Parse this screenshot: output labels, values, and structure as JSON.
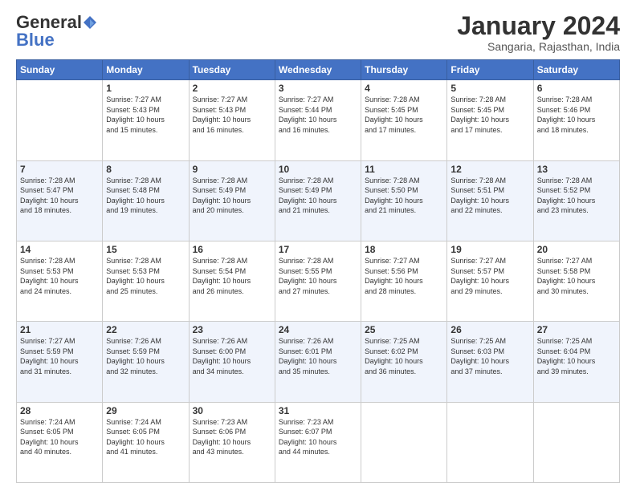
{
  "header": {
    "logo_general": "General",
    "logo_blue": "Blue",
    "month_title": "January 2024",
    "location": "Sangaria, Rajasthan, India"
  },
  "days_of_week": [
    "Sunday",
    "Monday",
    "Tuesday",
    "Wednesday",
    "Thursday",
    "Friday",
    "Saturday"
  ],
  "weeks": [
    [
      {
        "day": "",
        "content": ""
      },
      {
        "day": "1",
        "content": "Sunrise: 7:27 AM\nSunset: 5:43 PM\nDaylight: 10 hours\nand 15 minutes."
      },
      {
        "day": "2",
        "content": "Sunrise: 7:27 AM\nSunset: 5:43 PM\nDaylight: 10 hours\nand 16 minutes."
      },
      {
        "day": "3",
        "content": "Sunrise: 7:27 AM\nSunset: 5:44 PM\nDaylight: 10 hours\nand 16 minutes."
      },
      {
        "day": "4",
        "content": "Sunrise: 7:28 AM\nSunset: 5:45 PM\nDaylight: 10 hours\nand 17 minutes."
      },
      {
        "day": "5",
        "content": "Sunrise: 7:28 AM\nSunset: 5:45 PM\nDaylight: 10 hours\nand 17 minutes."
      },
      {
        "day": "6",
        "content": "Sunrise: 7:28 AM\nSunset: 5:46 PM\nDaylight: 10 hours\nand 18 minutes."
      }
    ],
    [
      {
        "day": "7",
        "content": "Sunrise: 7:28 AM\nSunset: 5:47 PM\nDaylight: 10 hours\nand 18 minutes."
      },
      {
        "day": "8",
        "content": "Sunrise: 7:28 AM\nSunset: 5:48 PM\nDaylight: 10 hours\nand 19 minutes."
      },
      {
        "day": "9",
        "content": "Sunrise: 7:28 AM\nSunset: 5:49 PM\nDaylight: 10 hours\nand 20 minutes."
      },
      {
        "day": "10",
        "content": "Sunrise: 7:28 AM\nSunset: 5:49 PM\nDaylight: 10 hours\nand 21 minutes."
      },
      {
        "day": "11",
        "content": "Sunrise: 7:28 AM\nSunset: 5:50 PM\nDaylight: 10 hours\nand 21 minutes."
      },
      {
        "day": "12",
        "content": "Sunrise: 7:28 AM\nSunset: 5:51 PM\nDaylight: 10 hours\nand 22 minutes."
      },
      {
        "day": "13",
        "content": "Sunrise: 7:28 AM\nSunset: 5:52 PM\nDaylight: 10 hours\nand 23 minutes."
      }
    ],
    [
      {
        "day": "14",
        "content": "Sunrise: 7:28 AM\nSunset: 5:53 PM\nDaylight: 10 hours\nand 24 minutes."
      },
      {
        "day": "15",
        "content": "Sunrise: 7:28 AM\nSunset: 5:53 PM\nDaylight: 10 hours\nand 25 minutes."
      },
      {
        "day": "16",
        "content": "Sunrise: 7:28 AM\nSunset: 5:54 PM\nDaylight: 10 hours\nand 26 minutes."
      },
      {
        "day": "17",
        "content": "Sunrise: 7:28 AM\nSunset: 5:55 PM\nDaylight: 10 hours\nand 27 minutes."
      },
      {
        "day": "18",
        "content": "Sunrise: 7:27 AM\nSunset: 5:56 PM\nDaylight: 10 hours\nand 28 minutes."
      },
      {
        "day": "19",
        "content": "Sunrise: 7:27 AM\nSunset: 5:57 PM\nDaylight: 10 hours\nand 29 minutes."
      },
      {
        "day": "20",
        "content": "Sunrise: 7:27 AM\nSunset: 5:58 PM\nDaylight: 10 hours\nand 30 minutes."
      }
    ],
    [
      {
        "day": "21",
        "content": "Sunrise: 7:27 AM\nSunset: 5:59 PM\nDaylight: 10 hours\nand 31 minutes."
      },
      {
        "day": "22",
        "content": "Sunrise: 7:26 AM\nSunset: 5:59 PM\nDaylight: 10 hours\nand 32 minutes."
      },
      {
        "day": "23",
        "content": "Sunrise: 7:26 AM\nSunset: 6:00 PM\nDaylight: 10 hours\nand 34 minutes."
      },
      {
        "day": "24",
        "content": "Sunrise: 7:26 AM\nSunset: 6:01 PM\nDaylight: 10 hours\nand 35 minutes."
      },
      {
        "day": "25",
        "content": "Sunrise: 7:25 AM\nSunset: 6:02 PM\nDaylight: 10 hours\nand 36 minutes."
      },
      {
        "day": "26",
        "content": "Sunrise: 7:25 AM\nSunset: 6:03 PM\nDaylight: 10 hours\nand 37 minutes."
      },
      {
        "day": "27",
        "content": "Sunrise: 7:25 AM\nSunset: 6:04 PM\nDaylight: 10 hours\nand 39 minutes."
      }
    ],
    [
      {
        "day": "28",
        "content": "Sunrise: 7:24 AM\nSunset: 6:05 PM\nDaylight: 10 hours\nand 40 minutes."
      },
      {
        "day": "29",
        "content": "Sunrise: 7:24 AM\nSunset: 6:05 PM\nDaylight: 10 hours\nand 41 minutes."
      },
      {
        "day": "30",
        "content": "Sunrise: 7:23 AM\nSunset: 6:06 PM\nDaylight: 10 hours\nand 43 minutes."
      },
      {
        "day": "31",
        "content": "Sunrise: 7:23 AM\nSunset: 6:07 PM\nDaylight: 10 hours\nand 44 minutes."
      },
      {
        "day": "",
        "content": ""
      },
      {
        "day": "",
        "content": ""
      },
      {
        "day": "",
        "content": ""
      }
    ]
  ]
}
